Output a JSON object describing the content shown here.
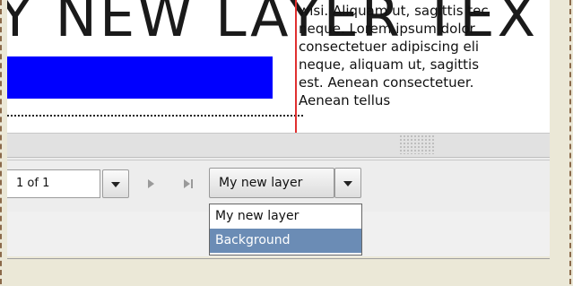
{
  "canvas": {
    "title_text": "Y NEW LAYER TEXT",
    "body_lines": [
      "wisi. Aliquam ut, sagittis tec",
      "neque. Lorem ipsum dolor",
      "consectetuer adipiscing eli",
      "neque, aliquam ut, sagittis",
      "est. Aenean consectetuer.",
      "Aenean tellus"
    ],
    "box_color": "#0000ff"
  },
  "toolbar": {
    "page_indicator": "1 of 1",
    "layer_select_value": "My new layer"
  },
  "layer_menu": {
    "options": [
      "My new layer",
      "Background"
    ],
    "highlighted": "Background"
  },
  "colors": {
    "highlight": "#6b8cb5",
    "guide_red": "#e03030"
  }
}
